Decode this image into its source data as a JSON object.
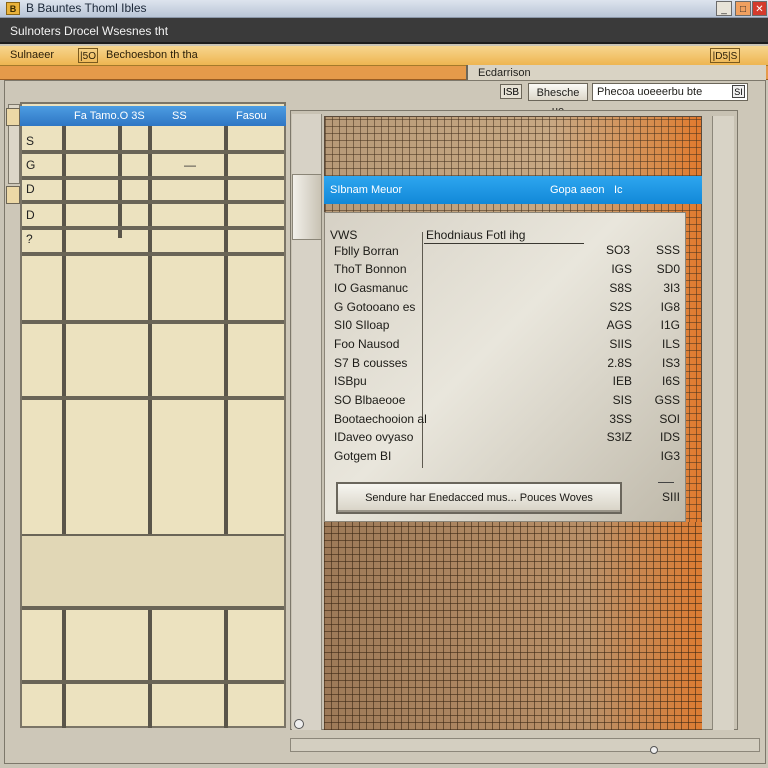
{
  "window": {
    "title": "B Bauntes Thoml Ibles",
    "app_icon": "B",
    "min": "_",
    "max": "□",
    "close": "✕"
  },
  "menubar": {
    "title": "Sulnoters Drocel Wsesnes tht"
  },
  "toolbar": {
    "label": "Sulnaeer",
    "sep": "|5O",
    "path": "Bechoesbon th tha",
    "right": "|D5|S"
  },
  "section_tab": "Ecdarrison",
  "controls": {
    "icon_label": "ISB",
    "button": "Bhesche ue",
    "search_value": "Phecoa uoeeerbu bte",
    "search_icon": "SI"
  },
  "left_table": {
    "headers": [
      "Fa Tamo.O 3S",
      "SS",
      "Fasou"
    ],
    "row_labels": [
      "S",
      "G",
      "D",
      "D",
      "?"
    ],
    "dash": "—"
  },
  "dialog": {
    "title": "SIbnam Meuor",
    "title_right": "Gopa aeon",
    "title_right_icon": "Ic",
    "header": {
      "label": "VWS",
      "col2": "Ehodniaus  Fotl ihg",
      "col3": "SO3",
      "col4": "SSS"
    },
    "rows": [
      {
        "label": "Fblly Borran",
        "v1": "",
        "v2": ""
      },
      {
        "label": "ThoT Bonnon",
        "v1": "IGS",
        "v2": "SD0"
      },
      {
        "label": "IO Gasmanuc",
        "v1": "S8S",
        "v2": "3I3"
      },
      {
        "label": "G Gotooano es",
        "v1": "S2S",
        "v2": "IG8"
      },
      {
        "label": "SI0 SIloap",
        "v1": "AGS",
        "v2": "I1G"
      },
      {
        "label": "Foo Nausod",
        "v1": "SIIS",
        "v2": "ILS"
      },
      {
        "label": "S7 B cousses",
        "v1": "2.8S",
        "v2": "IS3"
      },
      {
        "label": "ISBpu",
        "v1": "IEB",
        "v2": "I6S"
      },
      {
        "label": "SO Blbaeooe",
        "v1": "SIS",
        "v2": "GSS"
      },
      {
        "label": "Bootaechooion al",
        "v1": "3SS",
        "v2": "SOI"
      },
      {
        "label": "IDaveo ovyaso",
        "v1": "S3IZ",
        "v2": "IDS"
      },
      {
        "label": "Gotgem BI",
        "v1": "",
        "v2": "IG3"
      }
    ],
    "footer_button": "Sendure har Enedacced mus...  Pouces  Woves",
    "footer_value": "SIII"
  }
}
